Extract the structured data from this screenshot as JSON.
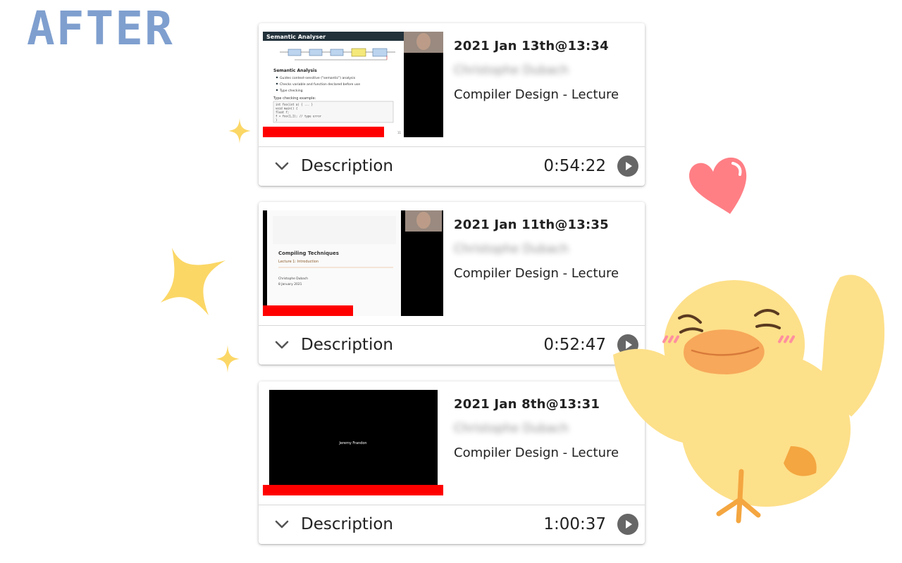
{
  "banner": {
    "title": "AFTER"
  },
  "icons": {
    "expand": "chevron-down-icon",
    "play": "play-circle-icon"
  },
  "colors": {
    "progress": "#ff0000",
    "title_accent": "#7f9fcf",
    "play_icon": "#666666"
  },
  "cards": [
    {
      "date": "2021 Jan 13th@13:34",
      "presenter": "Christophe Dubach",
      "course": "Compiler Design - Lecture",
      "description_label": "Description",
      "duration": "0:54:22",
      "progress": 0.67,
      "thumbnail": {
        "slide_title": "Semantic Analyser",
        "heading": "Semantic Analysis",
        "bullets": [
          "Guides context-sensitive (\"semantic\") analysis",
          "Checks variable and function declared before use",
          "Type checking"
        ],
        "code_caption": "Type checking example:",
        "code": [
          "int foo(int a) { ... }",
          "void main() {",
          "  float f;",
          "  f = foo(1,2); // type error",
          "}"
        ],
        "page": "11"
      }
    },
    {
      "date": "2021 Jan 11th@13:35",
      "presenter": "Christophe Dubach",
      "course": "Compiler Design - Lecture",
      "description_label": "Description",
      "duration": "0:52:47",
      "progress": 0.5,
      "thumbnail": {
        "slide_title": "Compiling Techniques",
        "subtitle": "Lecture 1: Introduction",
        "author": "Christophe Dubach",
        "date": "8 January 2021"
      }
    },
    {
      "date": "2021 Jan 8th@13:31",
      "presenter": "Christophe Dubach",
      "course": "Compiler Design - Lecture",
      "description_label": "Description",
      "duration": "1:00:37",
      "progress": 1.0,
      "thumbnail": {
        "caption": "Jeremy Frandon"
      }
    }
  ]
}
